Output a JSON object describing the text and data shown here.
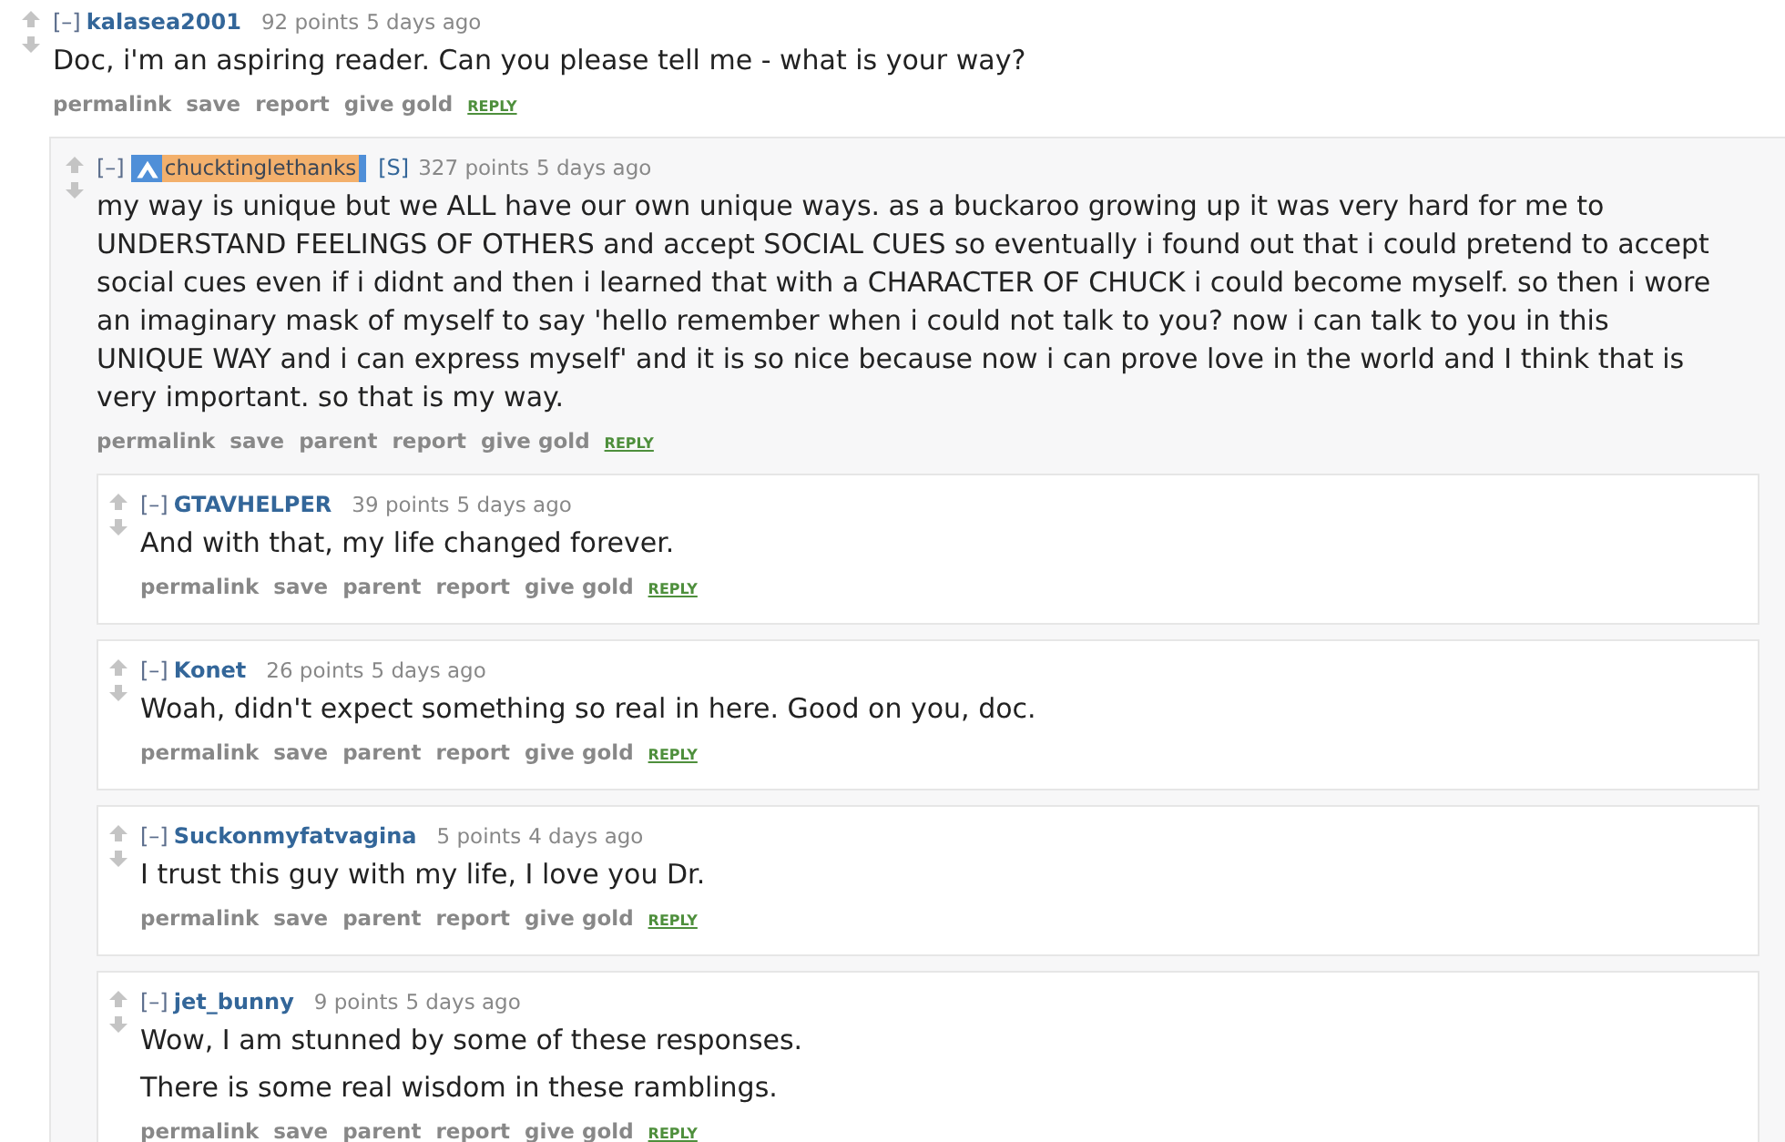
{
  "comments": [
    {
      "collapse": "[–]",
      "author": "kalasea2001",
      "highlighted": false,
      "score": "92 points",
      "time": "5 days ago",
      "paragraphs": [
        "Doc, i'm an aspiring reader. Can you please tell me - what is your way?"
      ],
      "actions": [
        "permalink",
        "save",
        "report",
        "give gold"
      ],
      "reply": "REPLY",
      "children": [
        {
          "collapse": "[–]",
          "author": "chucktinglethanks",
          "highlighted": true,
          "submitter_tag": "[S]",
          "score": "327 points",
          "time": "5 days ago",
          "paragraphs": [
            "my way is unique but we ALL have our own unique ways. as a buckaroo growing up it was very hard for me to UNDERSTAND FEELINGS OF OTHERS and accept SOCIAL CUES so eventually i found out that i could pretend to accept social cues even if i didnt and then i learned that with a CHARACTER OF CHUCK i could become myself. so then i wore an imaginary mask of myself to say 'hello remember when i could not talk to you? now i can talk to you in this UNIQUE WAY and i can express myself' and it is so nice because now i can prove love in the world and I think that is very important. so that is my way."
          ],
          "actions": [
            "permalink",
            "save",
            "parent",
            "report",
            "give gold"
          ],
          "reply": "REPLY",
          "children": [
            {
              "collapse": "[–]",
              "author": "GTAVHELPER",
              "highlighted": false,
              "score": "39 points",
              "time": "5 days ago",
              "paragraphs": [
                "And with that, my life changed forever."
              ],
              "actions": [
                "permalink",
                "save",
                "parent",
                "report",
                "give gold"
              ],
              "reply": "REPLY"
            },
            {
              "collapse": "[–]",
              "author": "Konet",
              "highlighted": false,
              "score": "26 points",
              "time": "5 days ago",
              "paragraphs": [
                "Woah, didn't expect something so real in here. Good on you, doc."
              ],
              "actions": [
                "permalink",
                "save",
                "parent",
                "report",
                "give gold"
              ],
              "reply": "REPLY"
            },
            {
              "collapse": "[–]",
              "author": "Suckonmyfatvagina",
              "highlighted": false,
              "score": "5 points",
              "time": "4 days ago",
              "paragraphs": [
                "I trust this guy with my life, I love you Dr."
              ],
              "actions": [
                "permalink",
                "save",
                "parent",
                "report",
                "give gold"
              ],
              "reply": "REPLY"
            },
            {
              "collapse": "[–]",
              "author": "jet_bunny",
              "highlighted": false,
              "score": "9 points",
              "time": "5 days ago",
              "paragraphs": [
                "Wow, I am stunned by some of these responses.",
                "There is some real wisdom in these ramblings."
              ],
              "actions": [
                "permalink",
                "save",
                "parent",
                "report",
                "give gold"
              ],
              "reply": "REPLY"
            }
          ]
        }
      ]
    }
  ]
}
